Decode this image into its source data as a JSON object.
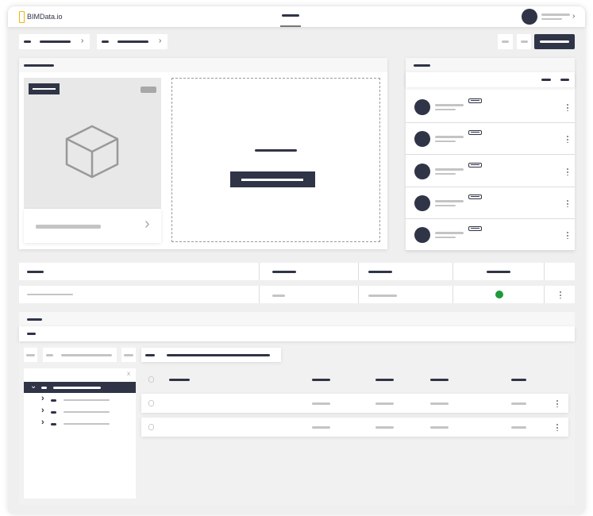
{
  "header": {
    "logo_text": "BIMData.io",
    "user_chevron": "›"
  },
  "breadcrumbs": [
    {
      "chevron": "›"
    },
    {
      "chevron": "›"
    }
  ],
  "project_card": {
    "footer_chevron": "›"
  },
  "members": {
    "count": 5
  },
  "models_table": {
    "status_color": "#1e9a3b"
  },
  "tree": {
    "close_label": "x",
    "expanded": "⌄",
    "collapsed": "›"
  },
  "colors": {
    "primary": "#2f3447",
    "background": "#efefef",
    "status_ok": "#1e9a3b"
  }
}
